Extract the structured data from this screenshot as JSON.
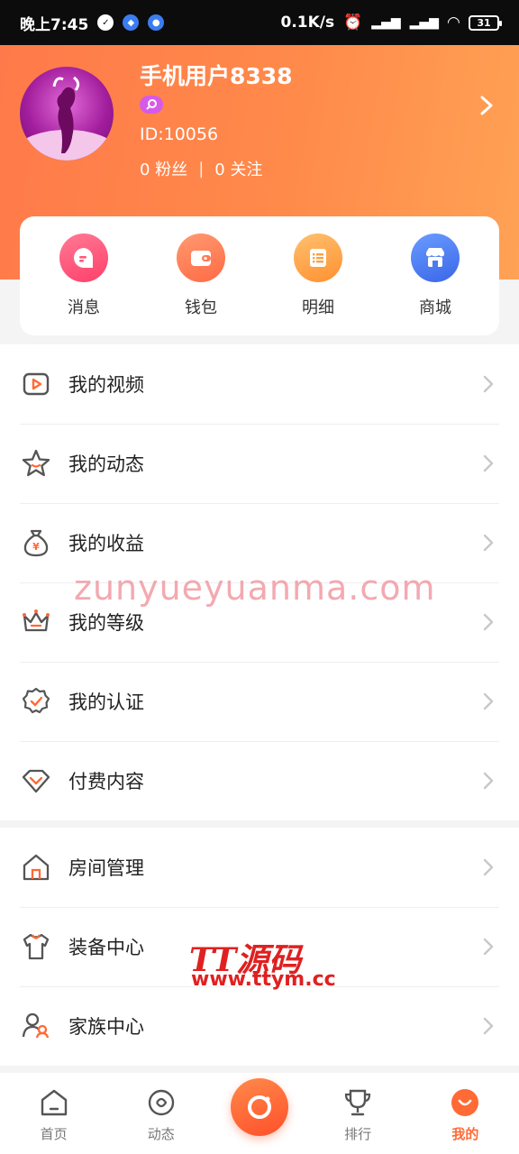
{
  "status_bar": {
    "time": "晚上7:45",
    "network_speed": "0.1K/s",
    "battery": "31"
  },
  "profile": {
    "username": "手机用户8338",
    "id": "ID:10056",
    "fans": "0 粉丝",
    "separator": "|",
    "following": "0 关注"
  },
  "quick_actions": [
    {
      "label": "消息",
      "icon": "message-icon",
      "color": "#ff5a7a"
    },
    {
      "label": "钱包",
      "icon": "wallet-icon",
      "color": "#ff7a55"
    },
    {
      "label": "明细",
      "icon": "list-icon",
      "color": "#ffa040"
    },
    {
      "label": "商城",
      "icon": "store-icon",
      "color": "#4a7cf0"
    }
  ],
  "menu_section1": [
    {
      "label": "我的视频",
      "icon": "video-icon"
    },
    {
      "label": "我的动态",
      "icon": "star-icon"
    },
    {
      "label": "我的收益",
      "icon": "money-bag-icon"
    },
    {
      "label": "我的等级",
      "icon": "crown-icon"
    },
    {
      "label": "我的认证",
      "icon": "verified-badge-icon"
    },
    {
      "label": "付费内容",
      "icon": "diamond-icon"
    }
  ],
  "menu_section2": [
    {
      "label": "房间管理",
      "icon": "home-icon"
    },
    {
      "label": "装备中心",
      "icon": "shirt-icon"
    },
    {
      "label": "家族中心",
      "icon": "family-icon"
    }
  ],
  "watermarks": {
    "site": "zunyueyuanma.com",
    "brand": "TT源码",
    "url": "www.ttym.cc"
  },
  "bottom_nav": [
    {
      "label": "首页",
      "icon": "home-nav-icon",
      "active": false
    },
    {
      "label": "动态",
      "icon": "dynamic-nav-icon",
      "active": false
    },
    {
      "label": "排行",
      "icon": "trophy-nav-icon",
      "active": false
    },
    {
      "label": "我的",
      "icon": "profile-nav-icon",
      "active": true
    }
  ],
  "colors": {
    "accent": "#ff6a35",
    "header_start": "#ff7a4a",
    "header_end": "#ffa255"
  }
}
